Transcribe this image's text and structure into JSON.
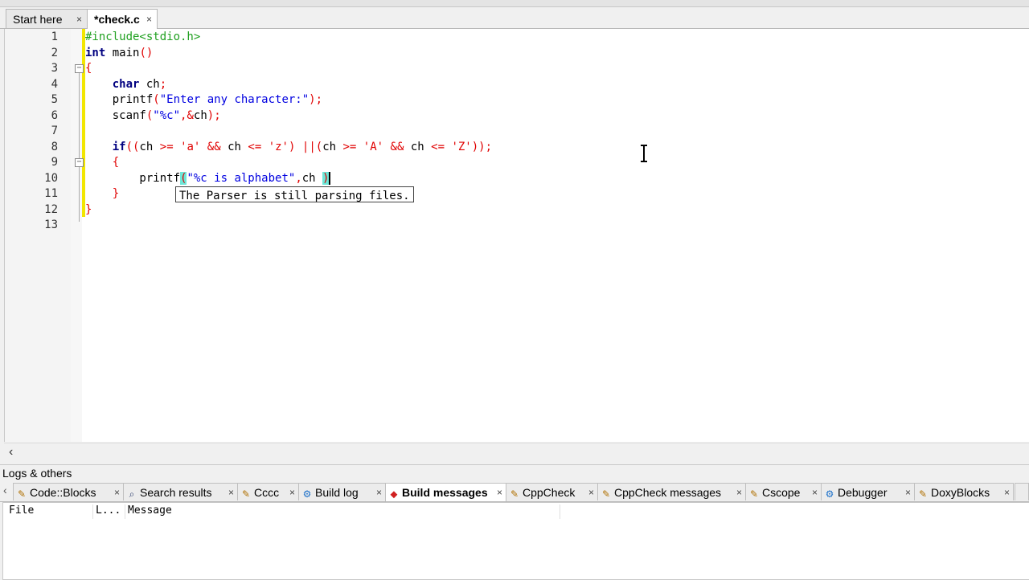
{
  "editor_tabs": [
    {
      "label": "Start here",
      "close": "×",
      "active": false
    },
    {
      "label": "*check.c",
      "close": "×",
      "active": true
    }
  ],
  "line_numbers": [
    "1",
    "2",
    "3",
    "4",
    "5",
    "6",
    "7",
    "8",
    "9",
    "10",
    "11",
    "12",
    "13"
  ],
  "code_lines": [
    "#include<stdio.h>",
    "int main()",
    "{",
    "    char ch;",
    "    printf(\"Enter any character:\");",
    "    scanf(\"%c\",&ch);",
    "",
    "    if((ch >= 'a' && ch <= 'z') ||(ch >= 'A' && ch <= 'Z'));",
    "    {",
    "        printf(\"%c is alphabet\",ch )",
    "    }",
    "}",
    ""
  ],
  "tooltip": "The Parser is still parsing files.",
  "panel_title": "Logs & others",
  "log_tabs": [
    {
      "label": "Code::Blocks",
      "icon": "pencil-icon",
      "active": false
    },
    {
      "label": "Search results",
      "icon": "search-icon",
      "active": false
    },
    {
      "label": "Cccc",
      "icon": "pencil-icon",
      "active": false
    },
    {
      "label": "Build log",
      "icon": "gear-icon",
      "active": false
    },
    {
      "label": "Build messages",
      "icon": "pin-icon",
      "active": true
    },
    {
      "label": "CppCheck",
      "icon": "pencil-icon",
      "active": false
    },
    {
      "label": "CppCheck messages",
      "icon": "pencil-icon",
      "active": false
    },
    {
      "label": "Cscope",
      "icon": "pencil-icon",
      "active": false
    },
    {
      "label": "Debugger",
      "icon": "gear-icon",
      "active": false
    },
    {
      "label": "DoxyBlocks",
      "icon": "pencil-icon",
      "active": false
    }
  ],
  "log_columns": [
    "File",
    "L...",
    "Message"
  ],
  "colors": {
    "keyword": "#000080",
    "preprocessor": "#20a020",
    "string": "#0000e0",
    "operator": "#e00000",
    "brace_highlight": "#6ee7d8",
    "change_bar": "#f2e600"
  }
}
